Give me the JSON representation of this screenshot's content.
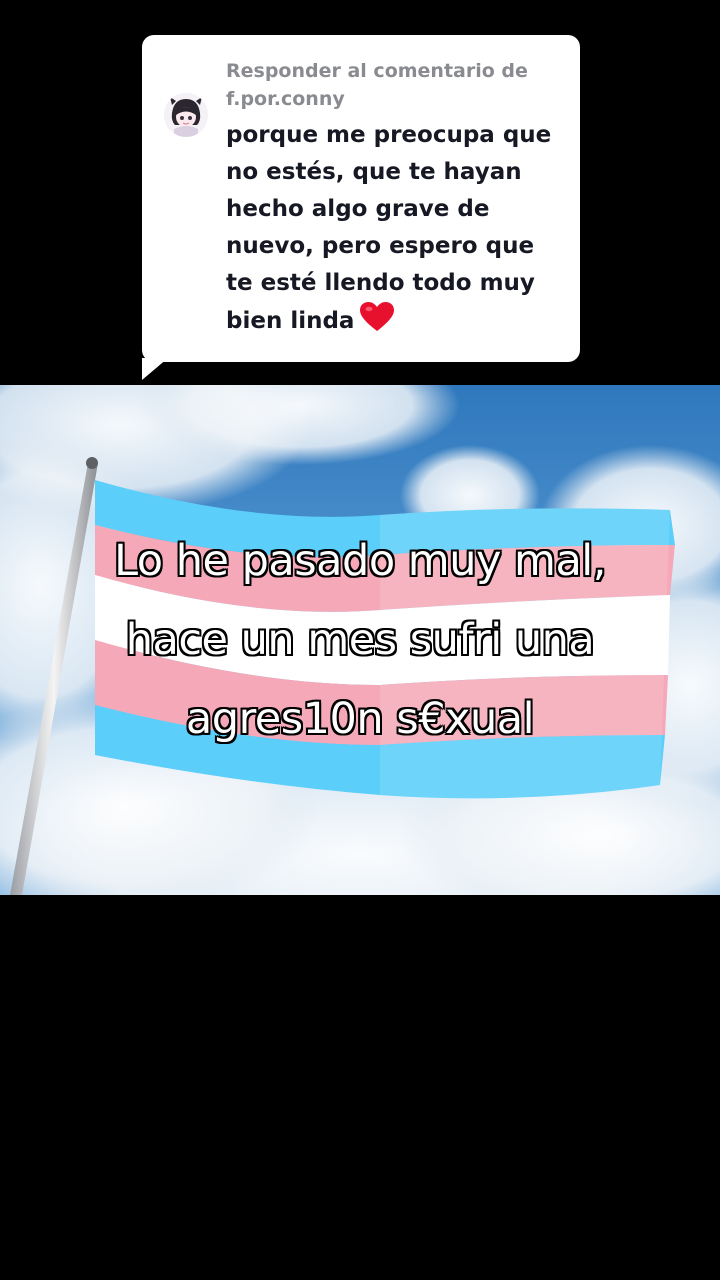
{
  "reply": {
    "header_line1": "Responder al comentario de",
    "header_line2": "f.por.conny",
    "comment_lines": [
      "porque me preocupa que",
      "no estés, que te hayan",
      "hecho algo grave de",
      "nuevo, pero espero que",
      "te esté llendo todo muy",
      "bien linda"
    ],
    "emoji": "heart-icon"
  },
  "caption": {
    "lines": [
      "Lo he pasado muy mal,",
      "hace un mes sufri una",
      "agres10n s€xual"
    ]
  },
  "colors": {
    "background": "#000000",
    "bubble": "#ffffff",
    "header_text": "#8a8b91",
    "comment_text": "#161823",
    "heart": "#e8112d",
    "flag_blue": "#5bcefa",
    "flag_pink": "#f5a9b8",
    "flag_white": "#ffffff",
    "sky": "#3d86c6"
  }
}
